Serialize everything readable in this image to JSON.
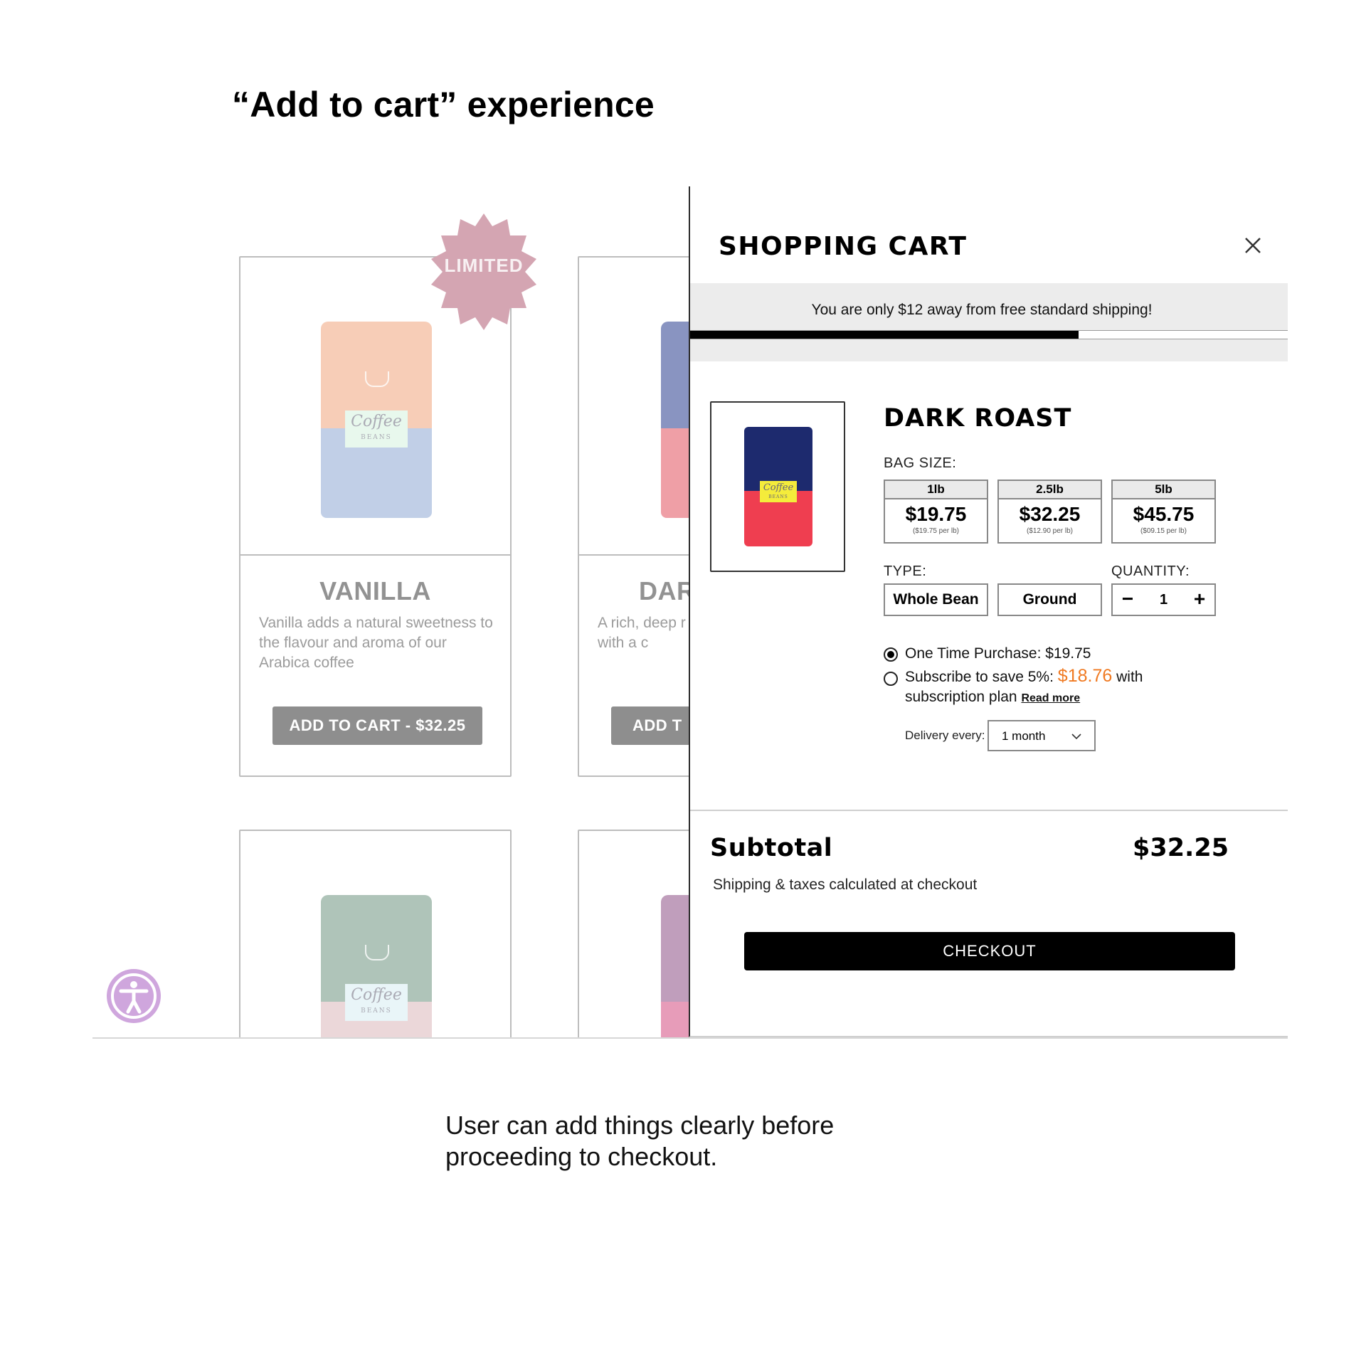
{
  "heading": "“Add to cart” experience",
  "caption": "User can add things clearly before proceeding to checkout.",
  "colors": {
    "badge": "#b15c74",
    "progress_fill": "#000000",
    "discount_price": "#f07a22",
    "checkout_bg": "#000000",
    "accessibility_button": "#cfa6dd"
  },
  "products": [
    {
      "title": "VANILLA",
      "description": "Vanilla adds a natural sweetness to the flavour and aroma of our Arabica coffee",
      "button": "ADD TO CART - $32.25",
      "badge": "LIMITED",
      "bag_label": "Coffee",
      "bag_sublabel": "BEANS"
    },
    {
      "title": "DAR",
      "description": "A rich, deep r beans. Very c great with a c",
      "button": "ADD T"
    },
    {
      "bag_label": "Coffee",
      "bag_sublabel": "BEANS"
    }
  ],
  "cart": {
    "title": "SHOPPING CART",
    "close_icon": "close-icon",
    "shipping_message": "You are only $12 away from free standard shipping!",
    "shipping_progress": 0.65,
    "item": {
      "name": "DARK ROAST",
      "bag_label": "Coffee",
      "bag_sublabel": "BEANS",
      "bag_size_label": "BAG SIZE:",
      "sizes": [
        {
          "size": "1lb",
          "price": "$19.75",
          "per": "($19.75 per lb)"
        },
        {
          "size": "2.5lb",
          "price": "$32.25",
          "per": "($12.90 per lb)"
        },
        {
          "size": "5lb",
          "price": "$45.75",
          "per": "($09.15 per lb)"
        }
      ],
      "type_label": "TYPE:",
      "types": [
        "Whole Bean",
        "Ground"
      ],
      "quantity_label": "QUANTITY:",
      "quantity": "1",
      "quantity_minus": "−",
      "quantity_plus": "+",
      "option_one_time": "One Time Purchase: $19.75",
      "option_subscribe_prefix": "Subscribe to save 5%:",
      "option_subscribe_price": "$18.76",
      "option_subscribe_suffix": "with",
      "option_subscribe_line2": "subscription plan",
      "read_more": "Read more",
      "delivery_label": "Delivery every:",
      "delivery_value": "1 month"
    },
    "subtotal_label": "Subtotal",
    "subtotal_value": "$32.25",
    "shipping_note": "Shipping & taxes calculated at checkout",
    "checkout_label": "CHECKOUT"
  }
}
